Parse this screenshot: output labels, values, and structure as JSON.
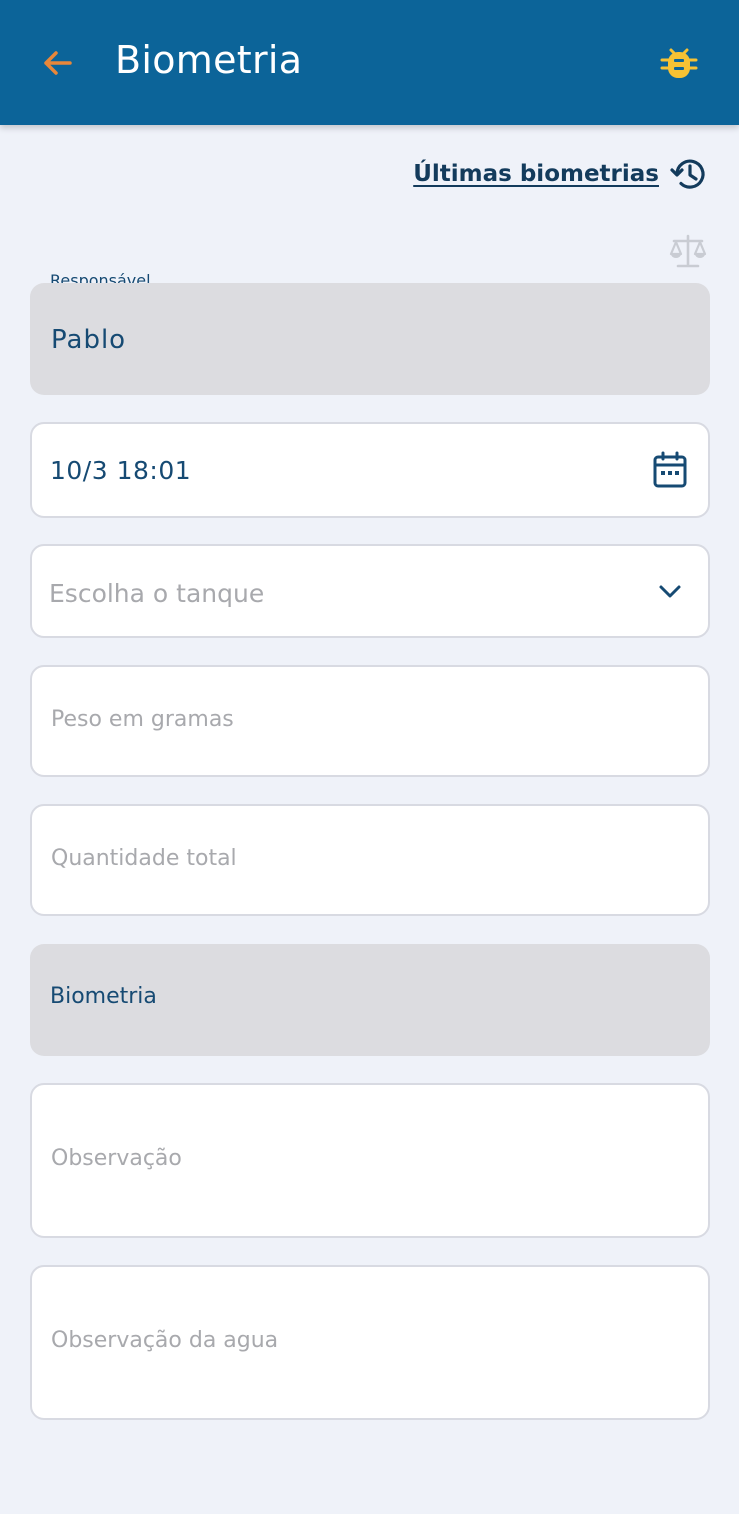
{
  "header": {
    "title": "Biometria",
    "back_icon": "arrow-left-icon",
    "debug_icon": "bug-icon"
  },
  "history": {
    "label": "Últimas biometrias",
    "icon": "history-icon"
  },
  "scale_icon": "scale-icon",
  "form": {
    "responsavel": {
      "label": "Responsável",
      "value": "Pablo"
    },
    "datetime": {
      "value": "10/3 18:01",
      "icon": "calendar-icon"
    },
    "tanque": {
      "placeholder": "Escolha o tanque",
      "icon": "chevron-down-icon"
    },
    "peso": {
      "placeholder": "Peso em gramas"
    },
    "quantidade": {
      "placeholder": "Quantidade total"
    },
    "tipo": {
      "value": "Biometria"
    },
    "observacao": {
      "placeholder": "Observação"
    },
    "observacao_agua": {
      "placeholder": "Observação da agua"
    }
  },
  "colors": {
    "appbar": "#0c6499",
    "accent_orange": "#e8873a",
    "bug_yellow": "#f7c234",
    "text_primary": "#164a73",
    "background": "#eff2f9"
  }
}
